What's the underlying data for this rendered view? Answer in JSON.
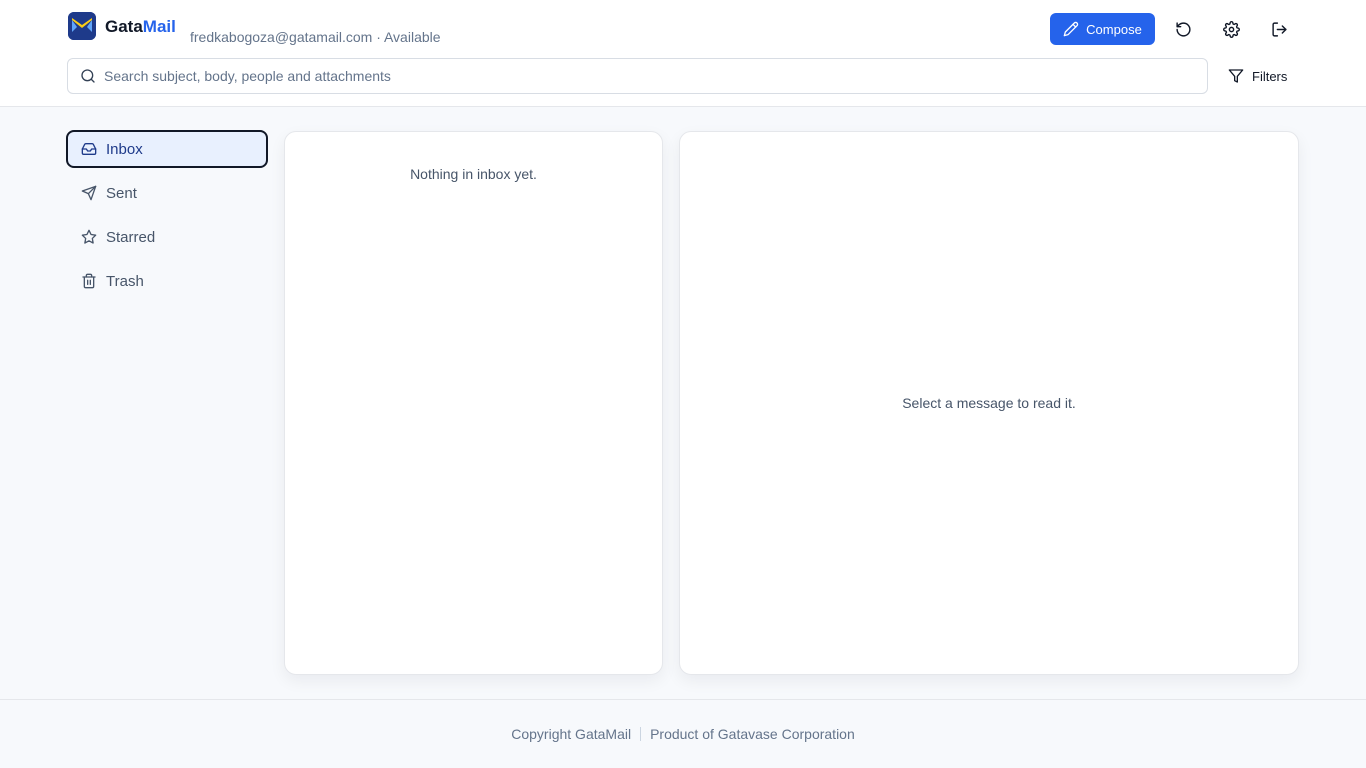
{
  "brand": {
    "name_part1": "Gata",
    "name_part2": "Mail"
  },
  "account": {
    "email_status": "fredkabogoza@gatamail.com · Available"
  },
  "toolbar": {
    "compose_label": "Compose",
    "refresh_icon": "refresh-icon",
    "settings_icon": "gear-icon",
    "logout_icon": "logout-icon"
  },
  "search": {
    "placeholder": "Search subject, body, people and attachments"
  },
  "filters": {
    "label": "Filters"
  },
  "sidebar": {
    "items": [
      {
        "label": "Inbox",
        "icon": "inbox-icon",
        "active": true
      },
      {
        "label": "Sent",
        "icon": "send-icon"
      },
      {
        "label": "Starred",
        "icon": "star-icon"
      },
      {
        "label": "Trash",
        "icon": "trash-icon"
      }
    ]
  },
  "list": {
    "empty_text": "Nothing in inbox yet."
  },
  "reader": {
    "empty_text": "Select a message to read it."
  },
  "footer": {
    "copyright": "Copyright GataMail",
    "product": "Product of Gatavase Corporation"
  },
  "colors": {
    "accent": "#2563eb",
    "brand_dark": "#1e3a8a",
    "active_bg": "#e8f0fe"
  }
}
